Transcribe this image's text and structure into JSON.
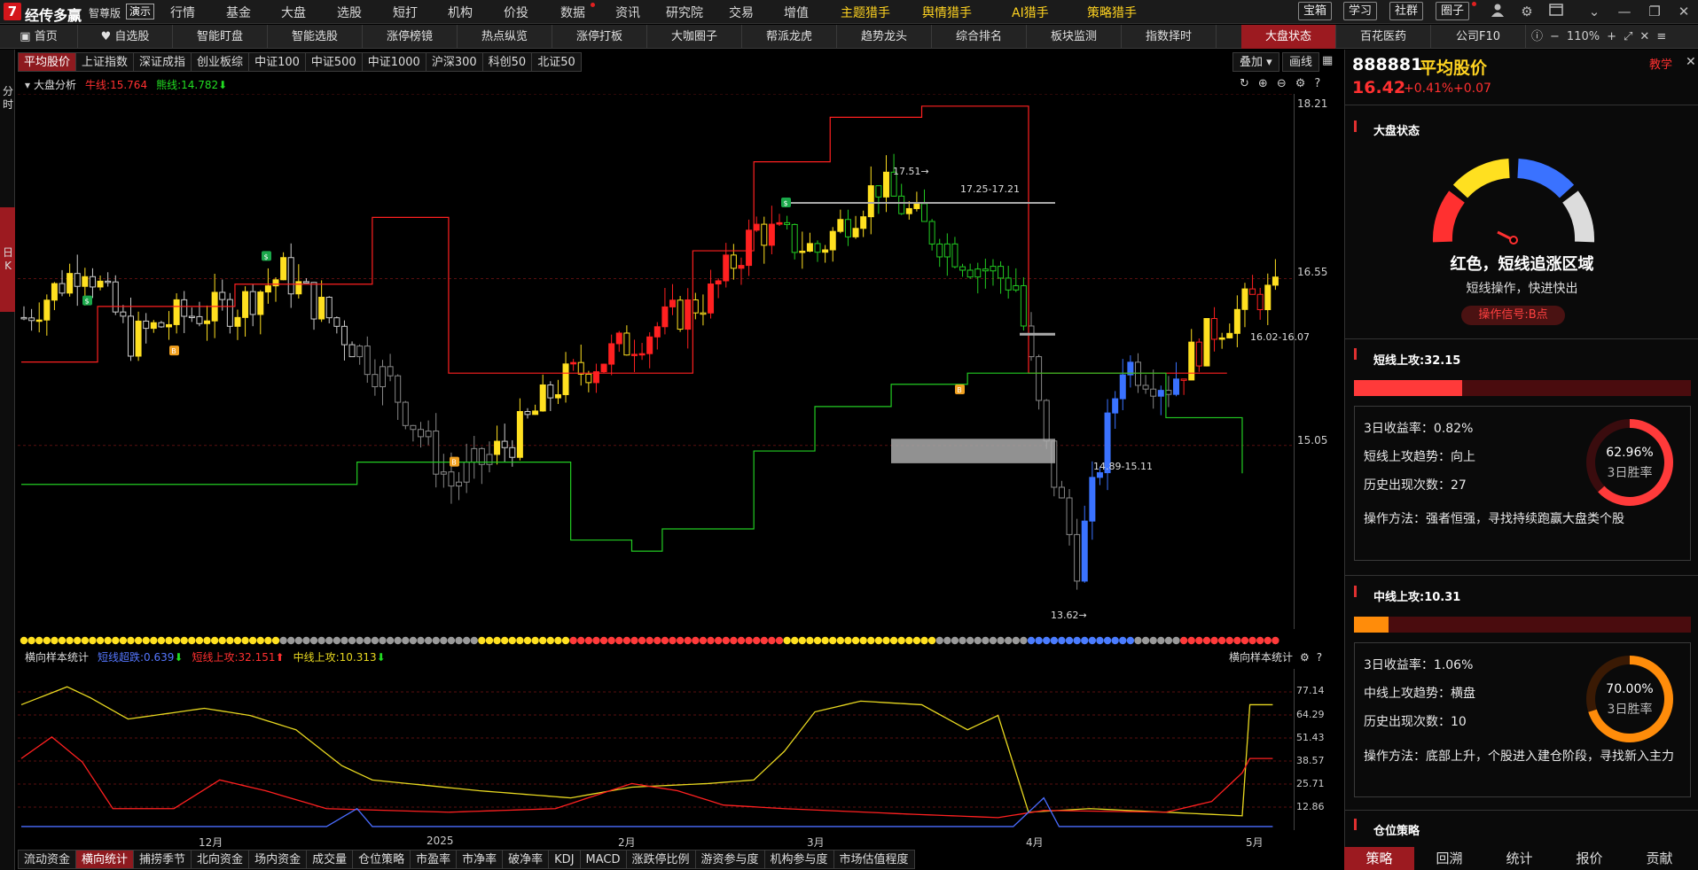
{
  "app": {
    "logo": "7",
    "name": "经传多赢",
    "edition": "智尊版",
    "demo": "演示"
  },
  "menu": [
    "行情",
    "基金",
    "大盘",
    "选股",
    "短打",
    "机构",
    "价投",
    "数据",
    "资讯",
    "研究院",
    "交易",
    "增值",
    "主题猎手",
    "舆情猎手",
    "AI猎手",
    "策略猎手"
  ],
  "toolbar_buttons": [
    "宝箱",
    "学习",
    "社群",
    "圈子"
  ],
  "nav_tabs": [
    "首页",
    "自选股",
    "智能盯盘",
    "智能选股",
    "涨停榜镜",
    "热点纵览",
    "涨停打板",
    "大咖圈子",
    "帮派龙虎",
    "趋势龙头",
    "综合排名",
    "板块监测",
    "指数择时",
    "大盘状态",
    "百花医药",
    "公司F10"
  ],
  "zoom": "110%",
  "left_strip": {
    "top": "分时",
    "day": "日K"
  },
  "index_tabs": [
    "平均股价",
    "上证指数",
    "深证成指",
    "创业板综",
    "中证100",
    "中证500",
    "中证1000",
    "沪深300",
    "科创50",
    "北证50"
  ],
  "chart_buttons": {
    "overlay": "叠加",
    "draw": "画线"
  },
  "legend_main": {
    "title": "大盘分析",
    "bull": "牛线:15.764",
    "bear": "熊线:14.782"
  },
  "legend_sub": {
    "title": "横向样本统计",
    "s1": "短线超跌:0.639",
    "s2": "短线上攻:32.151",
    "s3": "中线上攻:10.313",
    "right_title": "横向样本统计"
  },
  "annotations": {
    "high": "17.51",
    "resist": "17.25-17.21",
    "support_mid": "16.02-16.07",
    "support_low": "14.89-15.11",
    "low": "13.62"
  },
  "chart_data": [
    {
      "type": "candlestick",
      "y_ticks": [
        "18.21",
        "16.55",
        "15.05"
      ],
      "x_ticks": [
        "12月",
        "2025",
        "2月",
        "3月",
        "4月",
        "5月"
      ],
      "ylim": [
        13.4,
        18.21
      ],
      "series": [
        {
          "name": "牛线",
          "color": "#ff2020"
        },
        {
          "name": "熊线",
          "color": "#22cc22"
        }
      ]
    },
    {
      "type": "line",
      "y_ticks": [
        "77.14",
        "64.29",
        "51.43",
        "38.57",
        "25.71",
        "12.86"
      ],
      "series": [
        {
          "name": "短线超跌",
          "value": 0.639,
          "color": "#4a6cff"
        },
        {
          "name": "短线上攻",
          "value": 32.151,
          "color": "#ff2020"
        },
        {
          "name": "中线上攻",
          "value": 10.313,
          "color": "#e8d820"
        }
      ]
    }
  ],
  "quote": {
    "code": "888881",
    "name": "平均股价",
    "price": "16.42",
    "pct": "+0.41%",
    "chg": "+0.07",
    "teach": "教学"
  },
  "market_state": {
    "title": "大盘状态",
    "headline": "红色，短线追涨区域",
    "sub": "短线操作，快进快出",
    "signal": "操作信号:B点"
  },
  "short_attack": {
    "title": "短线上攻:32.15",
    "bar_pct": 0.32,
    "ret": "3日收益率：0.82%",
    "trend": "短线上攻趋势：向上",
    "count": "历史出现次数：27",
    "method": "操作方法：强者恒强，寻找持续跑赢大盘类个股",
    "winrate": "62.96%",
    "win_label": "3日胜率"
  },
  "mid_attack": {
    "title": "中线上攻:10.31",
    "bar_pct": 0.103,
    "ret": "3日收益率：1.06%",
    "trend": "中线上攻趋势：横盘",
    "count": "历史出现次数：10",
    "method": "操作方法：底部上升，个股进入建仓阶段，寻找新入主力",
    "winrate": "70.00%",
    "win_label": "3日胜率"
  },
  "position": {
    "title": "仓位策略"
  },
  "bottom_tabs": [
    "流动资金",
    "横向统计",
    "捕捞季节",
    "北向资金",
    "场内资金",
    "成交量",
    "仓位策略",
    "市盈率",
    "市净率",
    "破净率",
    "KDJ",
    "MACD",
    "涨跌停比例",
    "游资参与度",
    "机构参与度",
    "市场估值程度"
  ],
  "right_bottom_tabs": [
    "策略",
    "回溯",
    "统计",
    "报价",
    "贡献"
  ]
}
